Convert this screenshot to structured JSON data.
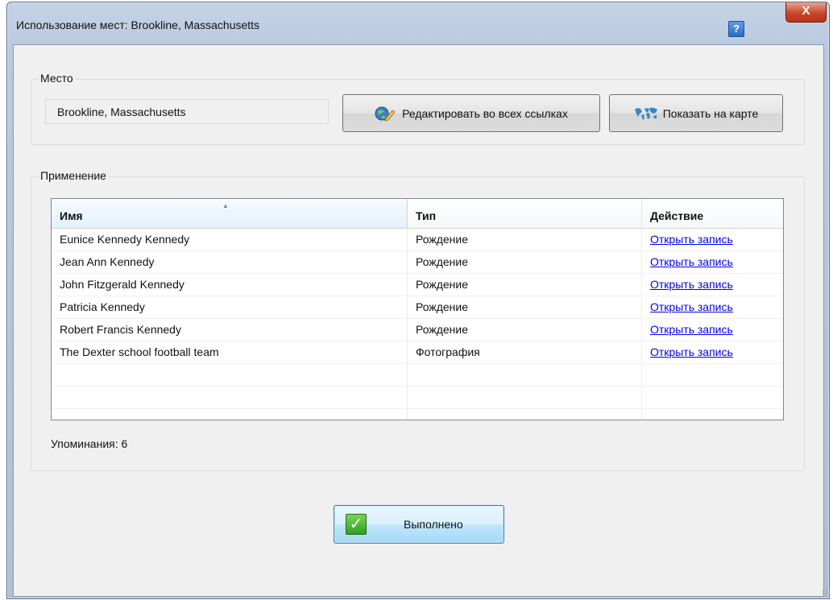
{
  "window": {
    "title": "Использование мест: Brookline, Massachusetts",
    "help_label": "?",
    "close_label": "X"
  },
  "place_group": {
    "legend": "Место",
    "value": "Brookline, Massachusetts",
    "edit_button_label": "Редактировать во всех ссылках",
    "map_button_label": "Показать на карте"
  },
  "usage_group": {
    "legend": "Применение",
    "columns": [
      "Имя",
      "Тип",
      "Действие"
    ],
    "rows": [
      {
        "name": "Eunice Kennedy Kennedy",
        "type": "Рождение",
        "action": "Открыть запись"
      },
      {
        "name": "Jean Ann Kennedy",
        "type": "Рождение",
        "action": "Открыть запись"
      },
      {
        "name": "John Fitzgerald Kennedy",
        "type": "Рождение",
        "action": "Открыть запись"
      },
      {
        "name": "Patricia Kennedy",
        "type": "Рождение",
        "action": "Открыть запись"
      },
      {
        "name": "Robert Francis Kennedy",
        "type": "Рождение",
        "action": "Открыть запись"
      },
      {
        "name": "The Dexter school football team",
        "type": "Фотография",
        "action": "Открыть запись"
      }
    ],
    "count_label": "Упоминания: 6"
  },
  "footer": {
    "done_label": "Выполнено",
    "done_icon": "✓"
  },
  "icons": {
    "help": "help-icon",
    "close": "close-icon",
    "edit": "edit-globe-pencil-icon",
    "map": "world-map-icon",
    "check": "check-icon",
    "sort": "sort-ascending-icon"
  },
  "colors": {
    "link": "#0000ee",
    "done_border": "#3c7fb1",
    "check_green": "#2f9e1e"
  }
}
